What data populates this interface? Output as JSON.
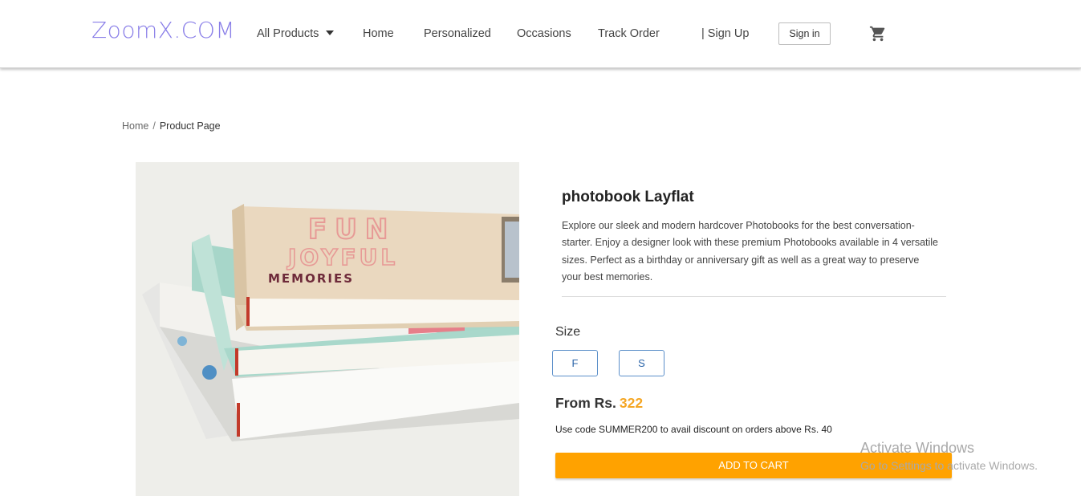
{
  "header": {
    "logo": "ZoomX.COM",
    "nav": {
      "all_products": "All Products",
      "home": "Home",
      "personalized": "Personalized",
      "occasions": "Occasions",
      "track_order": "Track Order",
      "sign_up": "| Sign Up"
    },
    "sign_in": "Sign in",
    "cart_icon": "shopping-cart-icon"
  },
  "breadcrumb": {
    "home": "Home",
    "separator": "/",
    "current": "Product Page"
  },
  "product": {
    "title": "photobook Layflat",
    "description": "Explore our sleek and modern hardcover Photobooks for the best conversation-starter. Enjoy a designer look with these premium Photobooks available in 4 versatile sizes. Perfect as a birthday or anniversary gift as well as a great way to preserve your best memories.",
    "size_label": "Size",
    "sizes": [
      "F",
      "S"
    ],
    "price_prefix": "From Rs.",
    "price": "322",
    "promo": "Use code SUMMER200 to avail discount on orders above Rs. 40",
    "add_to_cart": "ADD TO CART",
    "cover_text": {
      "line1": "FUN",
      "line2": "JOYFUL",
      "line3": "MEMORIES"
    }
  },
  "watermark": {
    "line1": "Activate Windows",
    "line2": "Go to Settings to activate Windows."
  },
  "colors": {
    "logo": "#8a7fe8",
    "price_accent": "#f5a623",
    "add_to_cart_bg": "#ffa200",
    "size_button_border": "#5b8fc9"
  }
}
